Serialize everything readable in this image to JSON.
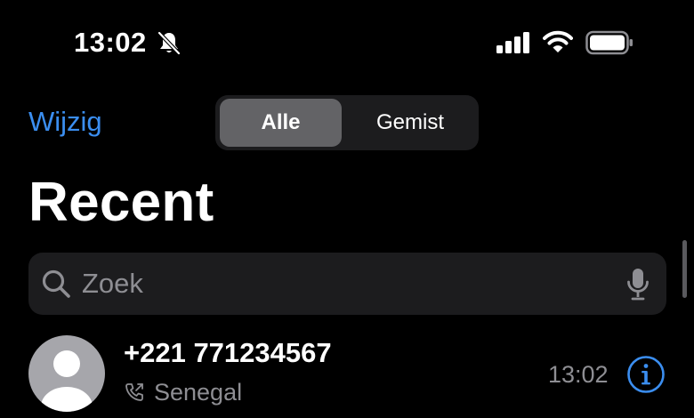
{
  "status_bar": {
    "time": "13:02",
    "icons": [
      "bell-slash-icon",
      "cellular-signal-icon",
      "wifi-icon",
      "battery-icon"
    ]
  },
  "nav": {
    "edit_label": "Wijzig",
    "segments": [
      {
        "label": "Alle",
        "selected": true
      },
      {
        "label": "Gemist",
        "selected": false
      }
    ]
  },
  "title": "Recent",
  "search": {
    "placeholder": "Zoek",
    "value": ""
  },
  "calls": [
    {
      "number": "+221 771234567",
      "label": "Senegal",
      "time": "13:02",
      "type_icon": "phone-outgoing-icon"
    }
  ],
  "colors": {
    "background": "#000000",
    "accent": "#3b8ef0",
    "secondary_text": "#8e8e93",
    "field_background": "#1c1c1e",
    "segment_selected": "#636366"
  }
}
